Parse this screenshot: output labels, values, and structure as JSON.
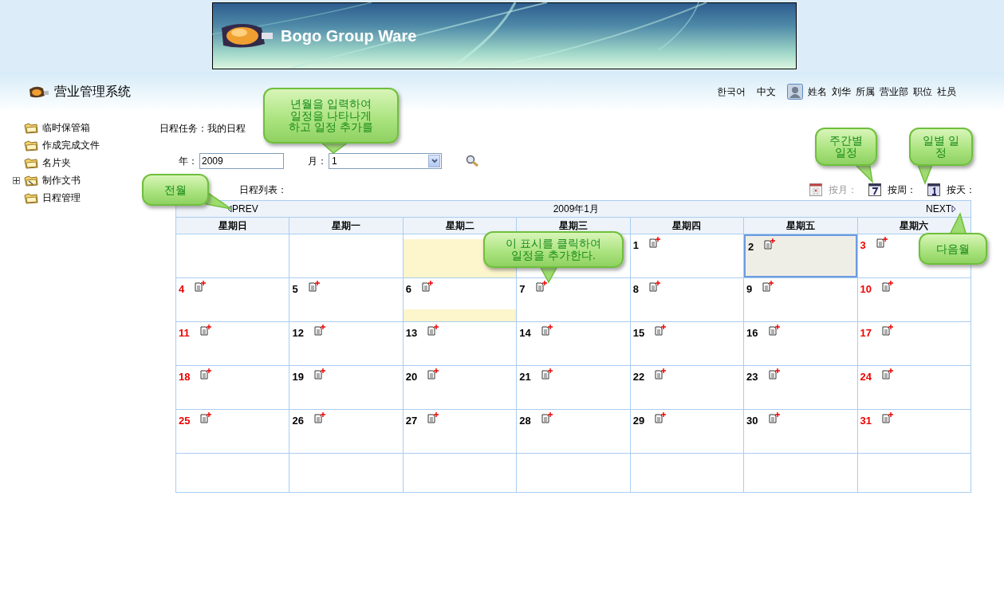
{
  "banner": {
    "title": "Bogo Group Ware"
  },
  "header": {
    "system_name": "营业管理系统",
    "languages": [
      "한국어",
      "中文"
    ],
    "user": {
      "name_label": "姓名",
      "name": "刘华",
      "dept_label": "所属",
      "dept": "营业部",
      "position_label": "职位",
      "position": "社员"
    }
  },
  "sidebar": {
    "items": [
      {
        "label": "临时保管箱",
        "kind": "leaf"
      },
      {
        "label": "作成完成文件",
        "kind": "leaf"
      },
      {
        "label": "名片夹",
        "kind": "leaf"
      },
      {
        "label": "制作文书",
        "kind": "branch",
        "expanded": false
      },
      {
        "label": "日程管理",
        "kind": "leaf"
      }
    ]
  },
  "main": {
    "breadcrumb": "日程任务：我的日程",
    "year_label": "年：",
    "year": "2009",
    "month_label": "月：",
    "month": "1",
    "list_label": "日程列表：",
    "views": [
      {
        "label": "按月：",
        "kind": "month",
        "selected": true
      },
      {
        "label": "按周：",
        "kind": "week",
        "selected": false
      },
      {
        "label": "按天：",
        "kind": "day",
        "selected": false
      }
    ]
  },
  "calendar": {
    "prev": "PREV",
    "title": "2009年1月",
    "next": "NEXT",
    "weekdays": [
      "星期日",
      "星期一",
      "星期二",
      "星期三",
      "星期四",
      "星期五",
      "星期六"
    ],
    "weeks": [
      [
        {
          "kind": "empty"
        },
        {
          "kind": "empty"
        },
        {
          "kind": "empty",
          "highlight": {
            "kind": "full"
          }
        },
        {
          "kind": "empty"
        },
        {
          "kind": "day",
          "day": "1",
          "selected": false
        },
        {
          "kind": "day",
          "day": "2",
          "selected": true
        },
        {
          "kind": "day",
          "day": "3",
          "selected": false
        }
      ],
      [
        {
          "kind": "day",
          "day": "4",
          "selected": false
        },
        {
          "kind": "day",
          "day": "5",
          "selected": false
        },
        {
          "kind": "day",
          "day": "6",
          "selected": false,
          "highlight": {
            "kind": "bottom"
          }
        },
        {
          "kind": "day",
          "day": "7",
          "selected": false
        },
        {
          "kind": "day",
          "day": "8",
          "selected": false
        },
        {
          "kind": "day",
          "day": "9",
          "selected": false
        },
        {
          "kind": "day",
          "day": "10",
          "selected": false
        }
      ],
      [
        {
          "kind": "day",
          "day": "11",
          "selected": false
        },
        {
          "kind": "day",
          "day": "12",
          "selected": false
        },
        {
          "kind": "day",
          "day": "13",
          "selected": false
        },
        {
          "kind": "day",
          "day": "14",
          "selected": false
        },
        {
          "kind": "day",
          "day": "15",
          "selected": false
        },
        {
          "kind": "day",
          "day": "16",
          "selected": false
        },
        {
          "kind": "day",
          "day": "17",
          "selected": false
        }
      ],
      [
        {
          "kind": "day",
          "day": "18",
          "selected": false
        },
        {
          "kind": "day",
          "day": "19",
          "selected": false
        },
        {
          "kind": "day",
          "day": "20",
          "selected": false
        },
        {
          "kind": "day",
          "day": "21",
          "selected": false
        },
        {
          "kind": "day",
          "day": "22",
          "selected": false
        },
        {
          "kind": "day",
          "day": "23",
          "selected": false
        },
        {
          "kind": "day",
          "day": "24",
          "selected": false
        }
      ],
      [
        {
          "kind": "day",
          "day": "25",
          "selected": false
        },
        {
          "kind": "day",
          "day": "26",
          "selected": false
        },
        {
          "kind": "day",
          "day": "27",
          "selected": false
        },
        {
          "kind": "day",
          "day": "28",
          "selected": false
        },
        {
          "kind": "day",
          "day": "29",
          "selected": false
        },
        {
          "kind": "day",
          "day": "30",
          "selected": false
        },
        {
          "kind": "day",
          "day": "31",
          "selected": false
        }
      ],
      [
        {
          "kind": "empty"
        },
        {
          "kind": "empty"
        },
        {
          "kind": "empty"
        },
        {
          "kind": "empty"
        },
        {
          "kind": "empty"
        },
        {
          "kind": "empty"
        },
        {
          "kind": "empty"
        }
      ]
    ]
  },
  "callouts": [
    {
      "text": "년월을 입력하여\n일정을 나타나게\n하고 일정 추가를"
    },
    {
      "text": "전월"
    },
    {
      "text": "주간별\n일정"
    },
    {
      "text": "일별 일\n정"
    },
    {
      "text": "이 표시를 클릭하여\n일정을 추가한다."
    },
    {
      "text": "다음월"
    }
  ]
}
